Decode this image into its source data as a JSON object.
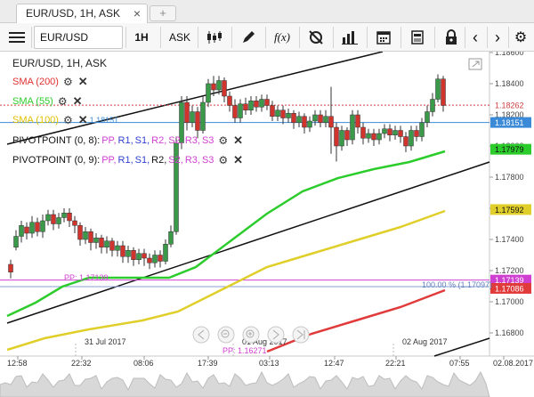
{
  "tabs": [
    {
      "label": "EUR/USD, 1H, ASK"
    }
  ],
  "toolbar": {
    "instrument": "EUR/USD",
    "period": "1H",
    "side": "ASK",
    "fx_label": "f(x)"
  },
  "chart": {
    "title": "EUR/USD, 1H, ASK",
    "indicators": [
      {
        "label": "SMA (200)",
        "color": "#e03030"
      },
      {
        "label": "SMA (55)",
        "color": "#2ccc2c"
      },
      {
        "label": "SMA (100)",
        "color": "#e0c000"
      }
    ],
    "sma100_extra": "1.18151",
    "pivots": [
      {
        "label": "PIVOTPOINT (0, 8):",
        "levels": [
          "PP,",
          "R1,",
          "S1,",
          "R2,",
          "S2,",
          "R3,",
          "S3"
        ]
      },
      {
        "label": "PIVOTPOINT (0, 9):",
        "levels": [
          "PP,",
          "R1,",
          "S1,",
          "R2,",
          "S2,",
          "R3,",
          "S3"
        ]
      }
    ],
    "price_labels": [
      "1.18600",
      "1.18400",
      "1.18200",
      "1.18000",
      "1.17800",
      "1.17600",
      "1.17400",
      "1.17200",
      "1.17000",
      "1.16800"
    ],
    "tags": {
      "last": "1.18262",
      "blue": "1.18151",
      "green": "1.17979",
      "yellow": "1.17592",
      "magenta": "1.17139",
      "red": "1.17086"
    },
    "pp_label": "PP: 1.17139",
    "pp_bottom": "PP: 1.16271",
    "fib_label": "100.00 % (1.17097)",
    "time_labels": [
      "12:58",
      "22:32",
      "08:06",
      "17:39",
      "03:13",
      "12:47",
      "22:21",
      "07:55",
      "02.08.2017"
    ],
    "date_labels": [
      "31 Jul 2017",
      "01 Aug 2017",
      "02 Aug 2017"
    ],
    "colors": {
      "bull": "#3a9a4a",
      "bear": "#d0342c",
      "blue_line": "#3b8ad8",
      "magenta": "#d040d0"
    }
  }
}
